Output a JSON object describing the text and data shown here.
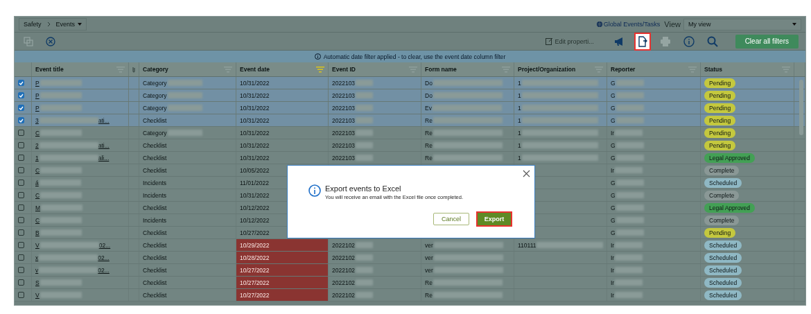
{
  "breadcrumb": [
    {
      "label": "Safety",
      "dropdown": false
    },
    {
      "label": "Events",
      "dropdown": true
    }
  ],
  "global_link": "Global Events/Tasks",
  "view_label": "View",
  "view_select": "My view",
  "toolbar": {
    "left_icons": [
      {
        "disabled": true
      },
      {
        "disabled": false
      }
    ],
    "edit_button": {
      "label": "Edit properti...",
      "disabled": true
    },
    "right_icons": [
      {
        "disabled": false,
        "highlighted": false
      },
      {
        "disabled": false,
        "highlighted": true
      },
      {
        "disabled": true,
        "highlighted": false
      },
      {
        "disabled": false,
        "highlighted": false
      },
      {
        "disabled": false,
        "highlighted": false
      }
    ],
    "clear_button": {
      "label": "Clear all filters",
      "disabled": true
    }
  },
  "banner": "Automatic date filter applied - to clear, use the event date column filter",
  "columns": [
    {
      "label": "Event title",
      "filter_active": false
    },
    {
      "label": "Category",
      "filter_active": false
    },
    {
      "label": "Event date",
      "filter_active": true
    },
    {
      "label": "Event ID",
      "filter_active": false
    },
    {
      "label": "Form name",
      "filter_active": false
    },
    {
      "label": "Project/Organization",
      "filter_active": false
    },
    {
      "label": "Reporter",
      "filter_active": false
    },
    {
      "label": "Status",
      "filter_active": false
    }
  ],
  "rows": [
    {
      "checked": true,
      "title": "P",
      "category": "Category",
      "category_blur": true,
      "date": "10/31/2022",
      "overdue": false,
      "id": "2022103",
      "form": "Do",
      "project": "1",
      "reporter": "G",
      "status": "Pending",
      "color": "#c4c83e"
    },
    {
      "checked": true,
      "title": "P",
      "category": "Category",
      "category_blur": true,
      "date": "10/31/2022",
      "overdue": false,
      "id": "2022103",
      "form": "Do",
      "project": "1",
      "reporter": "G",
      "status": "Pending",
      "color": "#c4c83e"
    },
    {
      "checked": true,
      "title": "P",
      "category": "Category",
      "category_blur": true,
      "date": "10/31/2022",
      "overdue": false,
      "id": "2022103",
      "form": "Ev",
      "project": "1",
      "reporter": "G",
      "status": "Pending",
      "color": "#c4c83e"
    },
    {
      "checked": true,
      "title": "3",
      "title_end": "ati...",
      "category": "Checklist",
      "category_blur": false,
      "date": "10/31/2022",
      "overdue": false,
      "id": "2022103",
      "form": "Re",
      "project": "1",
      "reporter": "G",
      "status": "Pending",
      "color": "#c4c83e"
    },
    {
      "checked": false,
      "title": "C",
      "category": "Category",
      "category_blur": true,
      "date": "10/31/2022",
      "overdue": false,
      "id": "2022103",
      "form": "Re",
      "project": "1",
      "reporter": "Ir",
      "status": "Pending",
      "color": "#c4c83e"
    },
    {
      "checked": false,
      "title": "2",
      "title_end": "ati...",
      "category": "Checklist",
      "category_blur": false,
      "date": "10/31/2022",
      "overdue": false,
      "id": "2022103",
      "form": "Re",
      "project": "1",
      "reporter": "G",
      "status": "Pending",
      "color": "#c4c83e"
    },
    {
      "checked": false,
      "title": "1",
      "title_end": "ali...",
      "category": "Checklist",
      "category_blur": false,
      "date": "10/31/2022",
      "overdue": false,
      "id": "2022103",
      "form": "Re",
      "project": "1",
      "reporter": "G",
      "status": "Legal Approved",
      "color": "#43a055"
    },
    {
      "checked": false,
      "title": "C",
      "category": "Checklist",
      "category_blur": false,
      "date": "10/05/2022",
      "overdue": false,
      "reporter": "Ir",
      "status": "Complete",
      "color": "#8a9896"
    },
    {
      "checked": false,
      "title": "á",
      "category": "Incidents",
      "category_blur": false,
      "date": "11/01/2022",
      "overdue": false,
      "reporter": "G",
      "status": "Scheduled",
      "color": "#8fb8c4"
    },
    {
      "checked": false,
      "title": "C",
      "category": "Incidents",
      "category_blur": false,
      "date": "10/31/2022",
      "overdue": false,
      "reporter": "G",
      "status": "Complete",
      "color": "#8a9896"
    },
    {
      "checked": false,
      "title": "M",
      "category": "Checklist",
      "category_blur": false,
      "date": "10/12/2022",
      "overdue": false,
      "reporter": "G",
      "status": "Legal Approved",
      "color": "#43a055"
    },
    {
      "checked": false,
      "title": "C",
      "category": "Incidents",
      "category_blur": false,
      "date": "10/12/2022",
      "overdue": false,
      "reporter": "G",
      "status": "Complete",
      "color": "#8a9896"
    },
    {
      "checked": false,
      "title": "B",
      "category": "Checklist",
      "category_blur": false,
      "date": "10/27/2022",
      "overdue": false,
      "reporter": "G",
      "status": "Pending",
      "color": "#c4c83e"
    },
    {
      "checked": false,
      "title": "V",
      "title_end": "02...",
      "category": "Checklist",
      "category_blur": false,
      "date": "10/29/2022",
      "overdue": true,
      "id": "2022102",
      "form": "ver",
      "project": "110111",
      "reporter": "Ir",
      "status": "Scheduled",
      "color": "#8fb8c4"
    },
    {
      "checked": false,
      "title": "x",
      "title_end": "02...",
      "category": "Checklist",
      "category_blur": false,
      "date": "10/28/2022",
      "overdue": true,
      "id": "2022102",
      "form": "ver",
      "reporter": "Ir",
      "status": "Scheduled",
      "color": "#8fb8c4"
    },
    {
      "checked": false,
      "title": "v",
      "title_end": "02...",
      "category": "Checklist",
      "category_blur": false,
      "date": "10/27/2022",
      "overdue": true,
      "id": "2022102",
      "form": "ver",
      "reporter": "Ir",
      "status": "Scheduled",
      "color": "#8fb8c4"
    },
    {
      "checked": false,
      "title": "S",
      "category": "Checklist",
      "category_blur": false,
      "date": "10/27/2022",
      "overdue": true,
      "id": "2022102",
      "form": "Re",
      "reporter": "Ir",
      "status": "Scheduled",
      "color": "#8fb8c4"
    },
    {
      "checked": false,
      "title": "V",
      "category": "Checklist",
      "category_blur": false,
      "date": "10/27/2022",
      "overdue": true,
      "id": "2022102",
      "form": "Re",
      "reporter": "Ir",
      "status": "Scheduled",
      "color": "#8fb8c4"
    }
  ],
  "modal": {
    "title": "Export events to Excel",
    "message": "You will receive an email with the Excel file once completed.",
    "cancel": "Cancel",
    "export": {
      "label": "Export",
      "highlighted": true
    }
  }
}
